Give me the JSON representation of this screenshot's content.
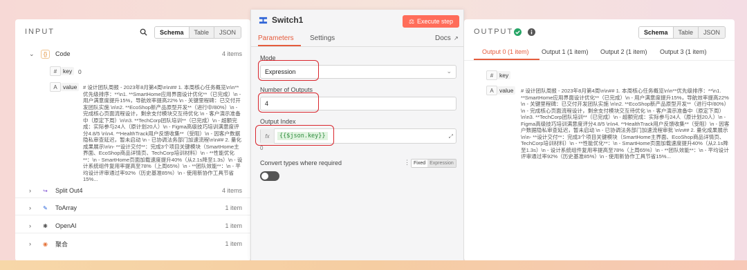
{
  "input": {
    "title": "INPUT",
    "view_modes": [
      "Schema",
      "Table",
      "JSON"
    ],
    "nodes": [
      {
        "name": "Code",
        "count": "4 items",
        "icon": "code-braces-icon"
      },
      {
        "name": "Split Out4",
        "count": "4 items",
        "icon": "split-icon"
      },
      {
        "name": "ToArray",
        "count": "1 item",
        "icon": "pen-icon"
      },
      {
        "name": "OpenAI",
        "count": "1 item",
        "icon": "openai-icon"
      },
      {
        "name": "聚合",
        "count": "1 item",
        "icon": "aggregate-icon"
      }
    ],
    "fields": [
      {
        "key": "key",
        "type": "#",
        "value": "0"
      },
      {
        "key": "value",
        "type": "A",
        "value": "# 设计团队周报 - 2023年8月第4周\\n\\n## 1. 本周核心任务概览\\n\\n**优先级排序：**\\n1. **SmartHome应用界面设计优化**（已完成）\\n - 用户满意度提升15%，导航效率提高22% \\n - 关键里程碑：已交付开发团队实施 \\n\\n2. **EcoShop新产品原型开发**（进行中/80%）\\n - 完成核心页面流程设计，剩余支付模块交互待优化 \\n - 客户演示准备中（原定下周）\\n\\n3. **TechCorp团队培训**（已完成）\\n - 超额完成：实际参与24人（原计划20人）\\n - Figma高级技巧培训满意度评分4.8/5 \\n\\n4. **HealthTrack用户反馈收集**（受阻）\\n - 因客户数据隐私审查延迟，暂未启动 \\n - 已协调法务部门加速流程\\n\\n## 2. 量化成果展示\\n\\n- **设计交付**：完成3个项目关键模块（SmartHome主界面、EcoShop商品详情页、TechCorp培训材料）\\n - **性能优化**：\\n - SmartHome页面加载速度提升40%（从2.1s降至1.3s）\\n - 设计系统组件复用率提高至78%（上周65%）\\n - **团队效能**：\\n - 平均设计评审通过率92%（历史基准85%）\\n - 使用新协作工具节省15%..."
      }
    ]
  },
  "node": {
    "title": "Switch1",
    "execute_label": "Execute step",
    "tabs": [
      "Parameters",
      "Settings"
    ],
    "docs_label": "Docs",
    "mode_label": "Mode",
    "mode_value": "Expression",
    "outputs_label": "Number of Outputs",
    "outputs_value": "4",
    "index_label": "Output Index",
    "index_expression": "{{$json.key}}",
    "index_preview": "0",
    "convert_label": "Convert types where required",
    "fixed_label": "Fixed",
    "expression_label": "Expression"
  },
  "output": {
    "title": "OUTPUT",
    "view_modes": [
      "Schema",
      "Table",
      "JSON"
    ],
    "tabs": [
      "Output 0 (1 item)",
      "Output 1 (1 item)",
      "Output 2 (1 item)",
      "Output 3 (1 item)"
    ],
    "fields": [
      {
        "key": "key",
        "type": "#",
        "value": "0"
      },
      {
        "key": "value",
        "type": "A",
        "value": "# 设计团队周报 - 2023年8月第4周\\n\\n## 1. 本周核心任务概览\\n\\n**优先级排序：**\\n1. **SmartHome应用界面设计优化**（已完成）\\n - 用户满意度提升15%，导航效率提高22% \\n - 关键里程碑：已交付开发团队实施 \\n\\n2. **EcoShop新产品原型开发**（进行中/80%）\\n - 完成核心页面流程设计，剩余支付模块交互待优化 \\n - 客户演示准备中（原定下周）\\n\\n3. **TechCorp团队培训**（已完成）\\n - 超额完成：实际参与24人（原计划20人）\\n - Figma高级技巧培训满意度评分4.8/5 \\n\\n4. **HealthTrack用户反馈收集**（受阻）\\n - 因客户数据隐私审查延迟，暂未启动 \\n - 已协调法务部门加速流程审批 \\n\\n## 2. 量化成果展示\\n\\n- **设计交付**：完成3个项目关键模块（SmartHome主界面、EcoShop商品详情页、TechCorp培训材料）\\n - **性能优化**：\\n - SmartHome页面加载速度提升40%（从2.1s降至1.3s）\\n - 设计系统组件复用率提高至78%（上周65%）\\n - **团队效能**：\\n - 平均设计评审通过率92%（历史基准85%）\\n - 使用新协作工具节省15%..."
      }
    ]
  },
  "colors": {
    "accent": "#e55b3c",
    "execute": "#ff6d5a",
    "annotation": "#d9252c",
    "success": "#27a567"
  }
}
